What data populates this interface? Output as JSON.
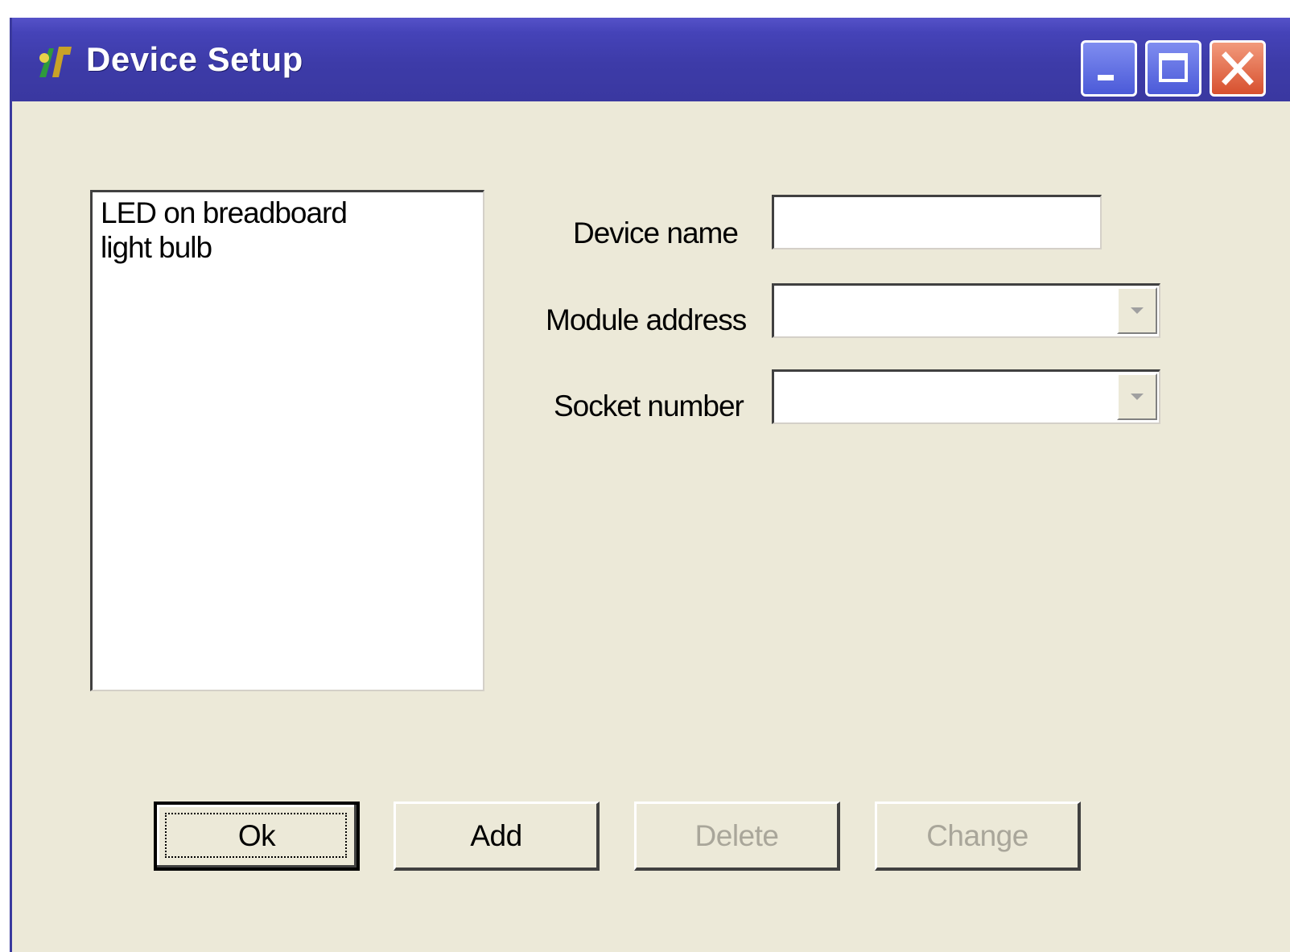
{
  "window": {
    "title": "Device Setup",
    "icon": "app-icon",
    "controls": [
      "minimize-icon",
      "maximize-icon",
      "close-icon"
    ]
  },
  "devices": {
    "items": [
      "LED on breadboard",
      "light bulb"
    ]
  },
  "form": {
    "device_name": {
      "label": "Device name",
      "value": ""
    },
    "module_address": {
      "label": "Module address",
      "value": ""
    },
    "socket_number": {
      "label": "Socket number",
      "value": ""
    }
  },
  "buttons": {
    "ok": "Ok",
    "add": "Add",
    "delete": "Delete",
    "change": "Change"
  },
  "colors": {
    "titlebar": "#3d3ba8",
    "face": "#ece9d8",
    "disabled_text": "#a9a69a",
    "close_button": "#d7502e"
  }
}
